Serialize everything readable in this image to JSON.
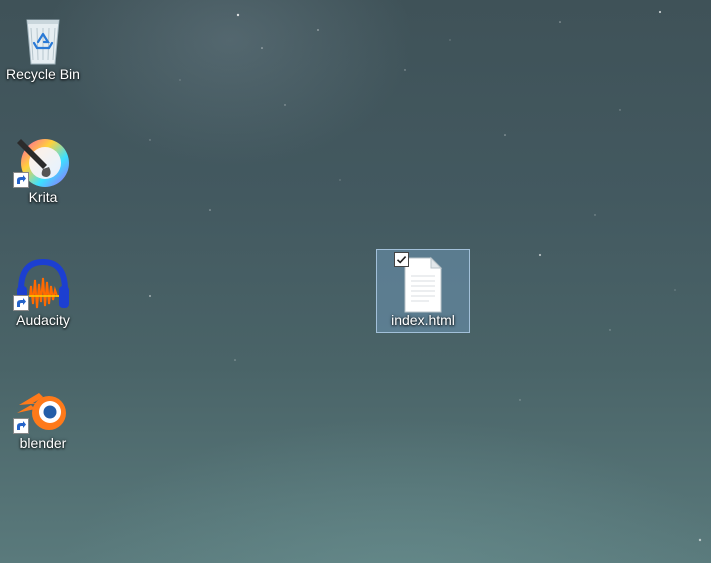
{
  "desktop": {
    "icons": [
      {
        "label": "Recycle Bin",
        "icon": "recycle-bin-icon",
        "shortcut": false
      },
      {
        "label": "Krita",
        "icon": "krita-icon",
        "shortcut": true
      },
      {
        "label": "Audacity",
        "icon": "audacity-icon",
        "shortcut": true
      },
      {
        "label": "blender",
        "icon": "blender-icon",
        "shortcut": true
      },
      {
        "label": "index.html",
        "icon": "html-file-icon",
        "shortcut": false,
        "selected": true,
        "checked": true
      }
    ]
  },
  "colors": {
    "selection_fill": "#6e96b4",
    "selection_border": "#aac8e1",
    "label_text": "#ffffff"
  }
}
